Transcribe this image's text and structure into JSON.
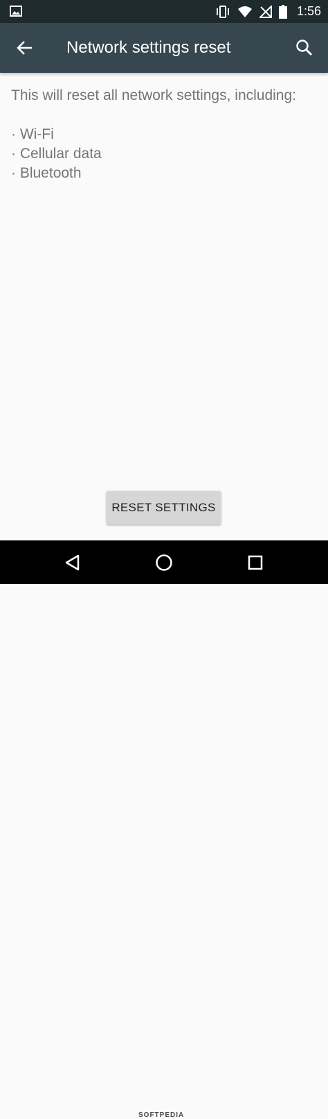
{
  "status_bar": {
    "time": "1:56",
    "icons": [
      "image-notification-icon",
      "vibrate-icon",
      "wifi-icon",
      "no-signal-icon",
      "battery-icon"
    ]
  },
  "app_bar": {
    "title": "Network settings reset",
    "back_icon": "arrow-back-icon",
    "search_icon": "search-icon"
  },
  "content": {
    "description": "This will reset all network settings, including:",
    "items": [
      "· Wi-Fi",
      "· Cellular data",
      "· Bluetooth"
    ]
  },
  "reset_button": {
    "label": "RESET SETTINGS"
  },
  "nav_bar": {
    "icons": [
      "back-triangle-icon",
      "home-circle-icon",
      "recents-square-icon"
    ]
  },
  "watermark": "SOFTPEDIA",
  "colors": {
    "status_bar": "#1f2a2f",
    "app_bar": "#37474f",
    "background": "#fafafa",
    "text": "#757575",
    "button": "#d6d6d6"
  }
}
